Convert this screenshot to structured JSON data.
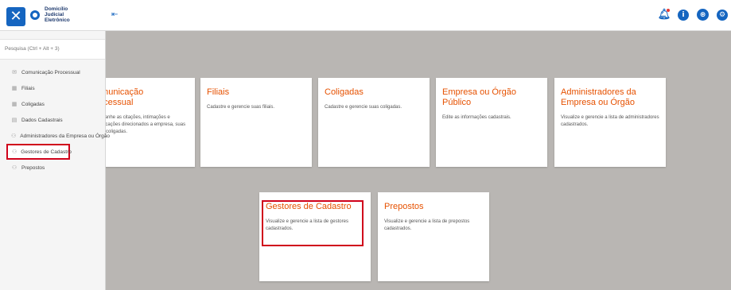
{
  "header": {
    "close_glyph": "✕",
    "logo_lines": [
      "Domicílio",
      "Judicial",
      "Eletrônico"
    ],
    "pin_icon": "pin-icon",
    "icons": [
      "bell-icon",
      "info-icon",
      "accessibility-icon",
      "user-settings-icon"
    ],
    "info_glyph": "i",
    "accessibility_glyph": "⊛",
    "user_glyph": "⚙"
  },
  "sidebar": {
    "search_placeholder": "Pesquisa (Ctrl + Alt + 3)",
    "items": [
      {
        "label": "Comunicação Processual",
        "icon": "envelope-icon"
      },
      {
        "label": "Filiais",
        "icon": "building-icon"
      },
      {
        "label": "Coligadas",
        "icon": "building-icon"
      },
      {
        "label": "Dados Cadastrais",
        "icon": "document-icon"
      },
      {
        "label": "Administradores da Empresa ou Órgão",
        "icon": "people-icon"
      },
      {
        "label": "Gestores de Cadastro",
        "icon": "people-icon",
        "selected": true
      },
      {
        "label": "Prepostos",
        "icon": "people-icon"
      }
    ]
  },
  "cards": [
    {
      "title": "Comunicação Processual",
      "desc": "Acompanhe as citações, intimações e comunicações direcionados a empresa, suas filiais e coligadas."
    },
    {
      "title": "Filiais",
      "desc": "Cadastre e gerencie suas filiais."
    },
    {
      "title": "Coligadas",
      "desc": "Cadastre e gerencie suas coligadas."
    },
    {
      "title": "Empresa ou Órgão Público",
      "desc": "Edite as informações cadastrais."
    },
    {
      "title": "Administradores da Empresa ou Órgão",
      "desc": "Visualize e gerencie a lista de administradores cadastrados."
    },
    {
      "title": "Gestores de Cadastro",
      "desc": "Visualize e gerencie a lista de gestores cadastrados."
    },
    {
      "title": "Prepostos",
      "desc": "Visualize e gerencie a lista de prepostos cadastrados."
    }
  ],
  "colors": {
    "brand": "#1565c0",
    "accent": "#e65100",
    "highlight": "#d0021b"
  }
}
